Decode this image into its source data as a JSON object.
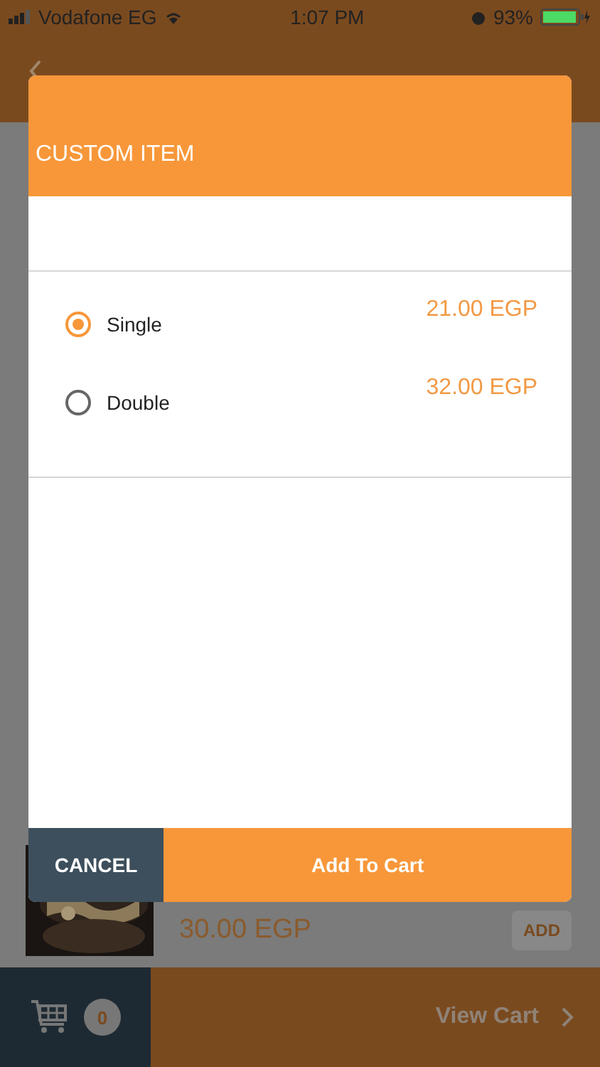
{
  "status_bar": {
    "carrier": "Vodafone EG",
    "time": "1:07 PM",
    "battery": "93%"
  },
  "menu_item": {
    "kind": "picture",
    "price": "30.00 EGP",
    "add_label": "ADD"
  },
  "cart_bar": {
    "count": "0",
    "label": "View Cart"
  },
  "dialog": {
    "title": "CUSTOM ITEM",
    "options": [
      {
        "label": "Single",
        "price": "21.00 EGP",
        "selected": true
      },
      {
        "label": "Double",
        "price": "32.00 EGP",
        "selected": false
      }
    ],
    "buttons": [
      {
        "kind": "cancel",
        "label": "CANCEL"
      },
      {
        "kind": "confirm",
        "label": "Add To Cart"
      }
    ]
  }
}
